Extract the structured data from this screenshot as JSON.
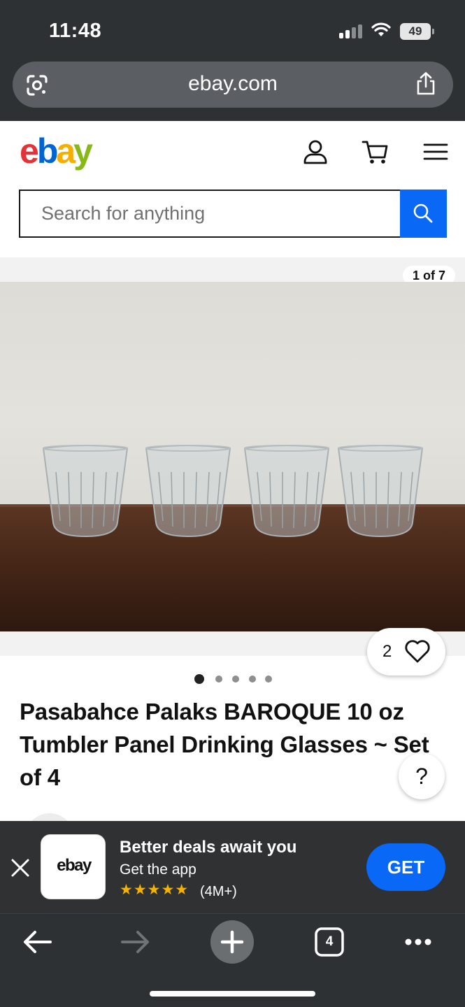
{
  "status_bar": {
    "time": "11:48",
    "battery": "49"
  },
  "browser": {
    "url": "ebay.com"
  },
  "header": {
    "logo_letters": [
      "e",
      "b",
      "a",
      "y"
    ],
    "search_placeholder": "Search for anything"
  },
  "gallery": {
    "counter": "1 of 7",
    "watch_count": "2",
    "dots_total": 5,
    "dots_active": 0
  },
  "product": {
    "title": "Pasabahce Palaks BAROQUE 10 oz Tumbler Panel Drinking Glasses ~ Set of 4"
  },
  "help": {
    "label": "?"
  },
  "app_banner": {
    "icon_text": "ebay",
    "title": "Better deals await you",
    "subtitle": "Get the app",
    "stars": "★★★★★",
    "rating": "(4M+)",
    "cta": "GET"
  },
  "toolbar": {
    "tab_count": "4"
  },
  "colors": {
    "ebay_red": "#e53238",
    "ebay_blue": "#0064d2",
    "ebay_yellow": "#f5af02",
    "ebay_green": "#86b817",
    "primary_blue": "#0968f6",
    "chrome_dark": "#2e3134"
  }
}
